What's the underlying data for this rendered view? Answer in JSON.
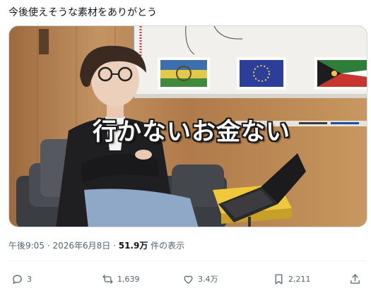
{
  "post": {
    "text": "今後使えそうな素材をありがとう"
  },
  "media": {
    "caption": "行かないお金ない"
  },
  "meta": {
    "time": "午後9:05",
    "separator": "·",
    "date": "2026年6月8日",
    "separator2": "·",
    "views_count": "51.9万",
    "views_label": "件の表示"
  },
  "actions": {
    "reply": {
      "icon": "reply-icon",
      "count": "3"
    },
    "repost": {
      "icon": "repost-icon",
      "count": "1,639"
    },
    "like": {
      "icon": "heart-icon",
      "count": "3.4万"
    },
    "bookmark": {
      "icon": "bookmark-icon",
      "count": "2,211"
    },
    "share": {
      "icon": "share-icon"
    }
  },
  "colors": {
    "text_primary": "#0f1419",
    "text_secondary": "#536471",
    "border": "#cfd9de"
  }
}
